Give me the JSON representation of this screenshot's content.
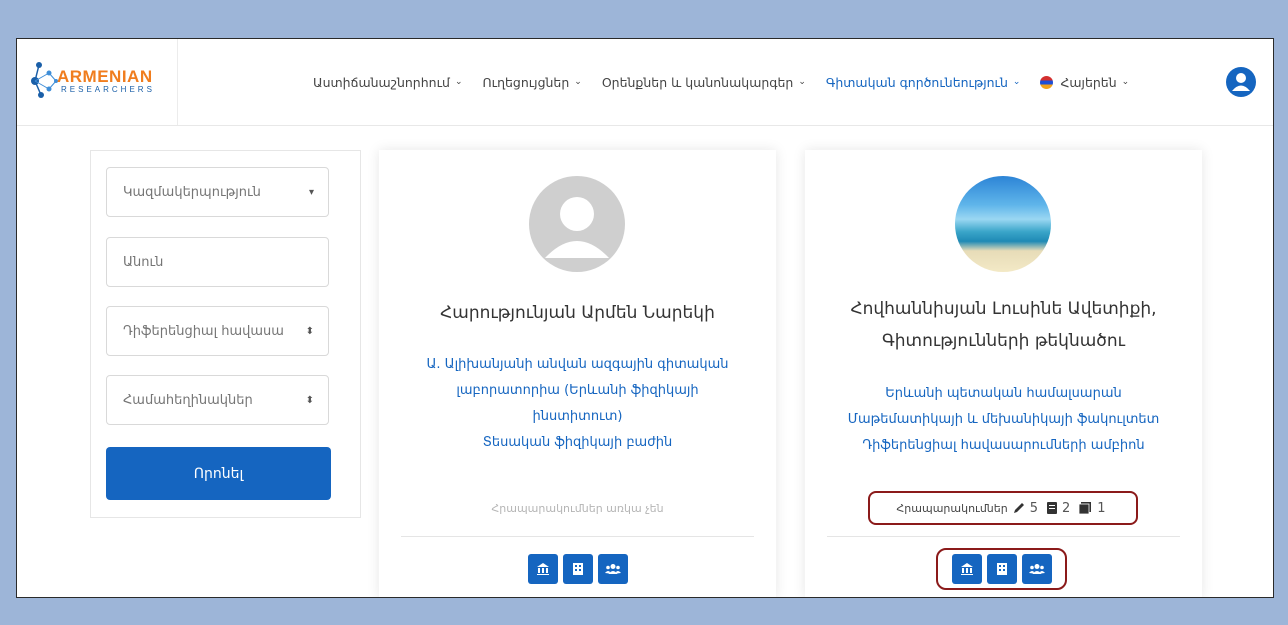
{
  "logo": {
    "text": "ARMENIAN",
    "subtext": "RESEARCHERS"
  },
  "nav": {
    "items": [
      {
        "label": "Աստիճանաշնորհում"
      },
      {
        "label": "Ուղեցույցներ"
      },
      {
        "label": "Օրենքներ և կանոնակարգեր"
      },
      {
        "label": "Գիտական գործունեություն"
      }
    ],
    "language": "Հայերեն"
  },
  "colors": {
    "accent": "#1565c0",
    "highlight": "#8b1a1a",
    "brand_orange": "#f07d1e"
  },
  "filters": {
    "organization": "Կազմակերպություն",
    "name_placeholder": "Անուն",
    "specialty": "Դիֆերենցիալ հավասա",
    "keywords": "Համահեղինակներ",
    "search_label": "Որոնել"
  },
  "cards": [
    {
      "name": "Հարությունյան Արմեն Նարեկի",
      "affiliation": [
        "Ա. Ալիխանյանի անվան ազգային գիտական",
        "լաբորատորիա (Երևանի ֆիզիկայի",
        "ինստիտուտ)",
        "Տեսական ֆիզիկայի բաժին"
      ],
      "publications_text": "Հրապարակումներ առկա չեն"
    },
    {
      "name": [
        "Հովհաննիսյան Լուսինե Ավետիքի,",
        "Գիտությունների թեկնածու"
      ],
      "affiliation": [
        "Երևանի պետական համալսարան",
        "Մաթեմատիկայի և մեխանիկայի ֆակուլտետ",
        "Դիֆերենցիալ հավասարումների ամբիոն"
      ],
      "publications_label": "Հրապարակումներ",
      "counts": {
        "articles": "5",
        "books": "2",
        "chapters": "1"
      }
    }
  ]
}
